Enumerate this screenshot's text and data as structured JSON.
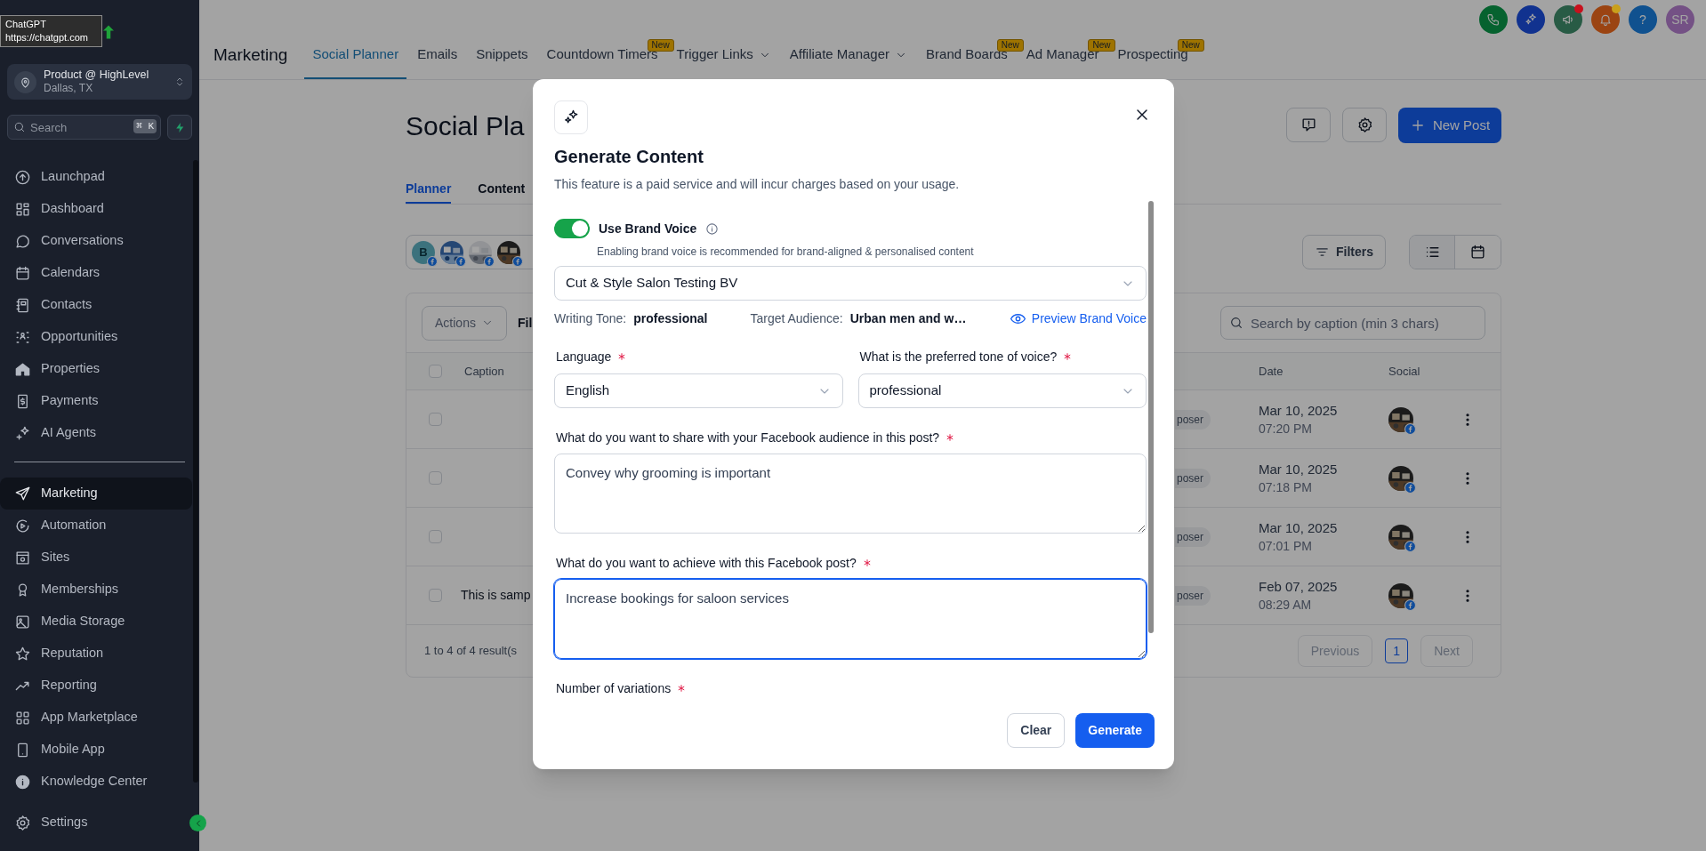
{
  "browser_tooltip": {
    "title": "ChatGPT",
    "url": "https://chatgpt.com"
  },
  "sidebar": {
    "account": {
      "name": "Product @ HighLevel",
      "location": "Dallas, TX"
    },
    "search": {
      "placeholder": "Search",
      "shortcut": "⌘ K"
    },
    "groups": [
      {
        "items": [
          {
            "label": "Launchpad",
            "selected": false
          },
          {
            "label": "Dashboard",
            "selected": false
          },
          {
            "label": "Conversations",
            "selected": false
          },
          {
            "label": "Calendars",
            "selected": false
          },
          {
            "label": "Contacts",
            "selected": false
          },
          {
            "label": "Opportunities",
            "selected": false
          },
          {
            "label": "Properties",
            "selected": false
          },
          {
            "label": "Payments",
            "selected": false
          },
          {
            "label": "AI Agents",
            "selected": false
          }
        ]
      },
      {
        "items": [
          {
            "label": "Marketing",
            "selected": true
          },
          {
            "label": "Automation",
            "selected": false
          },
          {
            "label": "Sites",
            "selected": false
          },
          {
            "label": "Memberships",
            "selected": false
          },
          {
            "label": "Media Storage",
            "selected": false
          },
          {
            "label": "Reputation",
            "selected": false
          },
          {
            "label": "Reporting",
            "selected": false
          },
          {
            "label": "App Marketplace",
            "selected": false
          },
          {
            "label": "Mobile App",
            "selected": false
          },
          {
            "label": "Knowledge Center",
            "selected": false
          }
        ]
      }
    ],
    "footer_item": {
      "label": "Settings",
      "selected": false
    }
  },
  "header_buttons": [
    {
      "notification": false
    },
    {
      "notification": false
    },
    {
      "notification": true,
      "color": "#c8111d"
    },
    {
      "notification": true,
      "color": "#c9a01b"
    },
    {
      "label": "?",
      "notification": false
    },
    {
      "label": "SR",
      "notification": false
    }
  ],
  "module_nav": {
    "title": "Marketing",
    "tabs": [
      {
        "label": "Social Planner",
        "selected": true,
        "dropdown": false
      },
      {
        "label": "Emails",
        "selected": false,
        "dropdown": false
      },
      {
        "label": "Snippets",
        "selected": false,
        "dropdown": false
      },
      {
        "label": "Countdown Timers",
        "selected": false,
        "dropdown": false,
        "badge": "New"
      },
      {
        "label": "Trigger Links",
        "selected": false,
        "dropdown": true
      },
      {
        "label": "Affiliate Manager",
        "selected": false,
        "dropdown": true
      },
      {
        "label": "Brand Boards",
        "selected": false,
        "dropdown": false,
        "badge": "New"
      },
      {
        "label": "Ad Manager",
        "selected": false,
        "dropdown": false,
        "badge": "New"
      },
      {
        "label": "Prospecting",
        "selected": false,
        "dropdown": false,
        "badge": "New"
      }
    ]
  },
  "page": {
    "title": "Social Pla",
    "new_post": "New Post",
    "tabs": [
      {
        "label": "Planner",
        "selected": true
      },
      {
        "label": "Content",
        "selected": false
      }
    ],
    "accounts": [
      {
        "kind": "letter",
        "label": "B"
      },
      {
        "kind": "picture"
      },
      {
        "kind": "picture"
      },
      {
        "kind": "picture"
      }
    ],
    "filters": "Filters",
    "view_toggle": [
      {
        "selected": true
      },
      {
        "selected": false
      }
    ],
    "table": {
      "actions": "Actions",
      "filter_label": "Fil",
      "search_placeholder": "Search by caption (min 3 chars)",
      "header_checked": false,
      "columns": [
        {
          "label": "Caption"
        },
        {
          "label": "Date"
        },
        {
          "label": "Social"
        }
      ],
      "rows": [
        {
          "checked": false,
          "status": "poser",
          "date": "Mar 10, 2025",
          "time": "07:20 PM"
        },
        {
          "checked": false,
          "status": "poser",
          "date": "Mar 10, 2025",
          "time": "07:18 PM"
        },
        {
          "checked": false,
          "status": "poser",
          "date": "Mar 10, 2025",
          "time": "07:01 PM"
        },
        {
          "checked": false,
          "caption": "This is samp",
          "status": "poser",
          "date": "Feb 07, 2025",
          "time": "08:29 AM"
        }
      ],
      "summary": "1 to 4 of 4 result(s",
      "previous": "Previous",
      "pages": [
        {
          "label": "1",
          "selected": true
        }
      ],
      "next": "Next"
    }
  },
  "dialog": {
    "title": "Generate Content",
    "subtitle": "This feature is a paid service and will incur charges based on your usage.",
    "brand_voice": {
      "label": "Use Brand Voice",
      "on": true,
      "hint": "Enabling brand voice is recommended for brand-aligned & personalised content",
      "value": "Cut & Style Salon Testing BV",
      "tone_label": "Writing Tone:",
      "tone": "professional",
      "audience_label": "Target Audience:",
      "audience": "Urban men and w…",
      "preview": "Preview Brand Voice"
    },
    "fields": [
      {
        "kind": "select",
        "label": "Language",
        "required": true,
        "value": "English"
      },
      {
        "kind": "select",
        "label": "What is the preferred tone of voice?",
        "required": true,
        "value": "professional"
      },
      {
        "kind": "textarea",
        "label": "What do you want to share with your Facebook audience in this post?",
        "required": true,
        "value": "Convey why grooming is important",
        "focused": false
      },
      {
        "kind": "textarea",
        "label": "What do you want to achieve with this Facebook post?",
        "required": true,
        "value": "Increase bookings for saloon services",
        "focused": true
      },
      {
        "kind": "label",
        "label": "Number of variations",
        "required": true
      }
    ],
    "buttons": [
      {
        "label": "Clear",
        "primary": false
      },
      {
        "label": "Generate",
        "primary": true
      }
    ]
  }
}
